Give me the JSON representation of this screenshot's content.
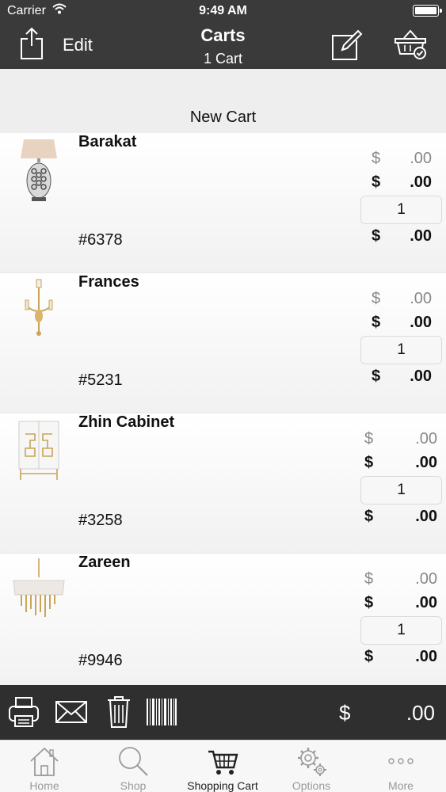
{
  "status_bar": {
    "carrier": "Carrier",
    "time": "9:49 AM"
  },
  "nav": {
    "edit_label": "Edit",
    "title": "Carts",
    "subtitle": "1 Cart"
  },
  "new_cart_label": "New Cart",
  "items": [
    {
      "name": "Barakat",
      "sku": "#6378",
      "price_cur": "$",
      "price_amt": ".00",
      "sale_cur": "$",
      "sale_amt": ".00",
      "qty": "1",
      "total_cur": "$",
      "total_amt": ".00"
    },
    {
      "name": "Frances",
      "sku": "#5231",
      "price_cur": "$",
      "price_amt": ".00",
      "sale_cur": "$",
      "sale_amt": ".00",
      "qty": "1",
      "total_cur": "$",
      "total_amt": ".00"
    },
    {
      "name": "Zhin Cabinet",
      "sku": "#3258",
      "price_cur": "$",
      "price_amt": ".00",
      "sale_cur": "$",
      "sale_amt": ".00",
      "qty": "1",
      "total_cur": "$",
      "total_amt": ".00"
    },
    {
      "name": "Zareen",
      "sku": "#9946",
      "price_cur": "$",
      "price_amt": ".00",
      "sale_cur": "$",
      "sale_amt": ".00",
      "qty": "1",
      "total_cur": "$",
      "total_amt": ".00"
    }
  ],
  "toolbar": {
    "icons": [
      "printer-icon",
      "mail-icon",
      "trash-icon",
      "barcode-icon"
    ],
    "total_cur": "$",
    "total_amt": ".00"
  },
  "tabs": [
    {
      "label": "Home",
      "icon": "home-icon"
    },
    {
      "label": "Shop",
      "icon": "search-icon"
    },
    {
      "label": "Shopping Cart",
      "icon": "cart-icon",
      "active": true
    },
    {
      "label": "Options",
      "icon": "gears-icon"
    },
    {
      "label": "More",
      "icon": "more-icon"
    }
  ],
  "colors": {
    "nav_bg": "#3a3a3a",
    "toolbar_bg": "#2f2f2f",
    "tabbar_bg": "#f7f7f7",
    "new_cart_bg": "#efeeee",
    "muted_text": "#888888"
  }
}
